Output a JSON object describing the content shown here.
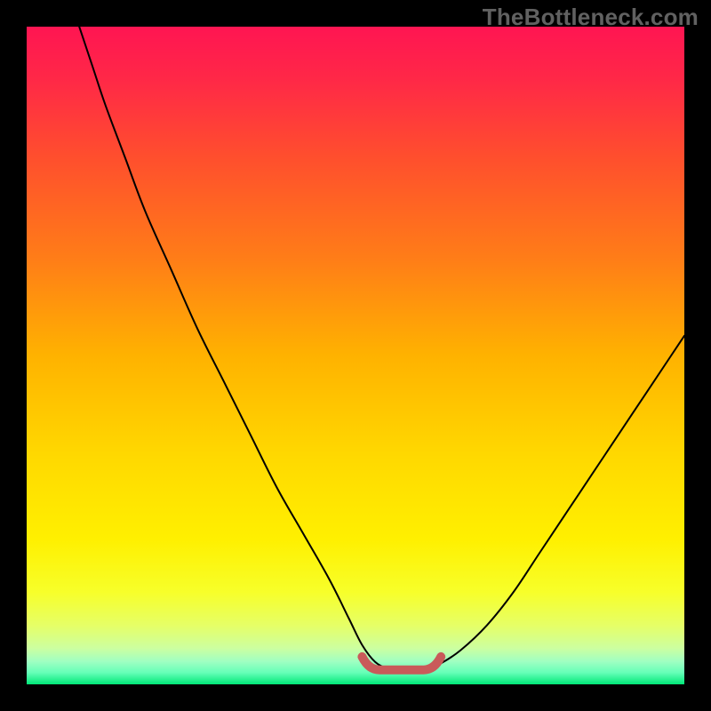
{
  "watermark": "TheBottleneck.com",
  "colors": {
    "gradient_stops": [
      {
        "offset": 0.0,
        "color": "#ff1552"
      },
      {
        "offset": 0.08,
        "color": "#ff2847"
      },
      {
        "offset": 0.2,
        "color": "#ff4f2d"
      },
      {
        "offset": 0.35,
        "color": "#ff7c18"
      },
      {
        "offset": 0.5,
        "color": "#ffb200"
      },
      {
        "offset": 0.65,
        "color": "#ffd800"
      },
      {
        "offset": 0.78,
        "color": "#fff000"
      },
      {
        "offset": 0.86,
        "color": "#f7ff2a"
      },
      {
        "offset": 0.91,
        "color": "#e6ff66"
      },
      {
        "offset": 0.945,
        "color": "#ccffa0"
      },
      {
        "offset": 0.965,
        "color": "#a0ffc2"
      },
      {
        "offset": 0.982,
        "color": "#66ffb8"
      },
      {
        "offset": 1.0,
        "color": "#00e878"
      }
    ],
    "curve": "#000000",
    "flat_marker": "#c95a5a"
  },
  "chart_data": {
    "type": "line",
    "title": "",
    "xlabel": "",
    "ylabel": "",
    "xlim": [
      0,
      100
    ],
    "ylim": [
      0,
      100
    ],
    "grid": false,
    "series": [
      {
        "name": "bottleneck-curve",
        "x": [
          8,
          10,
          12,
          15,
          18,
          22,
          26,
          30,
          34,
          38,
          42,
          46,
          49,
          51,
          53,
          55,
          57,
          59,
          61,
          63,
          66,
          70,
          74,
          78,
          82,
          86,
          90,
          94,
          98,
          100
        ],
        "values": [
          100,
          94,
          88,
          80,
          72,
          63,
          54,
          46,
          38,
          30,
          23,
          16,
          10,
          6,
          3.4,
          2.4,
          2.1,
          2.1,
          2.3,
          3.2,
          5.2,
          9,
          14,
          20,
          26,
          32,
          38,
          44,
          50,
          53
        ]
      }
    ],
    "flat_region": {
      "x_start": 51,
      "x_end": 63,
      "y": 2.2
    }
  }
}
